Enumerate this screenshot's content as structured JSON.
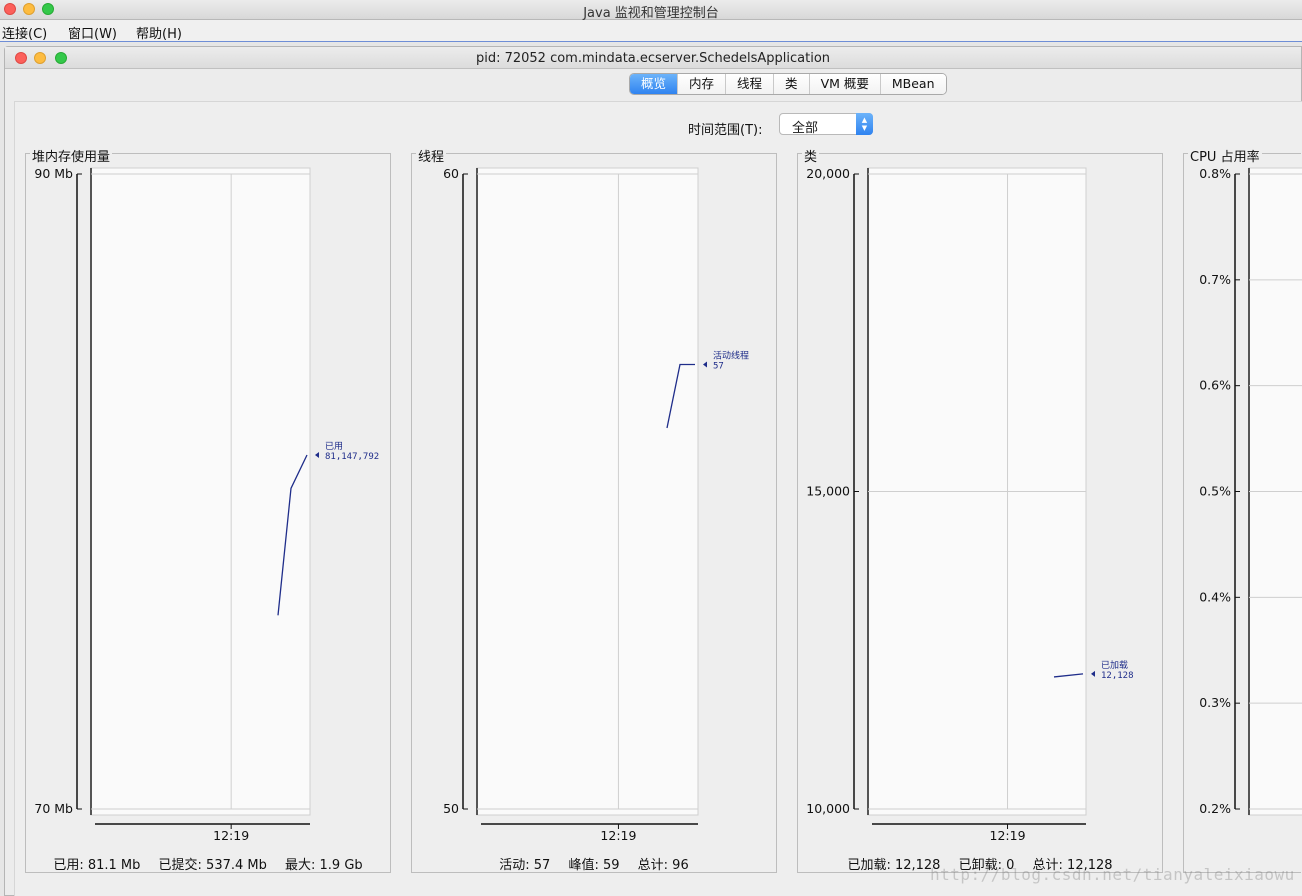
{
  "app": {
    "title": "Java 监视和管理控制台"
  },
  "menu": [
    "连接(C)",
    "窗口(W)",
    "帮助(H)"
  ],
  "window": {
    "title": "pid: 72052 com.mindata.ecserver.SchedelsApplication"
  },
  "tabs": [
    {
      "label": "概览",
      "active": true
    },
    {
      "label": "内存",
      "active": false
    },
    {
      "label": "线程",
      "active": false
    },
    {
      "label": "类",
      "active": false
    },
    {
      "label": "VM 概要",
      "active": false
    },
    {
      "label": "MBean",
      "active": false
    }
  ],
  "time_range": {
    "label": "时间范围(T):",
    "value": "全部"
  },
  "panels": {
    "heap": {
      "title": "堆内存使用量",
      "footer": {
        "used": "已用: 81.1 Mb",
        "committed": "已提交: 537.4 Mb",
        "max": "最大: 1.9 Gb"
      }
    },
    "threads": {
      "title": "线程",
      "footer": {
        "live": "活动: 57",
        "peak": "峰值: 59",
        "total": "总计: 96"
      }
    },
    "classes": {
      "title": "类",
      "footer": {
        "loaded": "已加载: 12,128",
        "unloaded": "已卸载: 0",
        "total": "总计: 12,128"
      }
    },
    "cpu": {
      "title": "CPU 占用率"
    }
  },
  "chart_data": [
    {
      "type": "line",
      "title": "堆内存使用量",
      "y_ticks": [
        "90 Mb",
        "70 Mb"
      ],
      "x_ticks": [
        "12:19"
      ],
      "ylim_mb": [
        70,
        90
      ],
      "series": [
        {
          "name": "已用",
          "label": "81,147,792",
          "values_mb": [
            76.1,
            80.1,
            81.15
          ]
        }
      ],
      "color": "#1f2d8a"
    },
    {
      "type": "line",
      "title": "线程",
      "y_ticks": [
        "60",
        "50"
      ],
      "x_ticks": [
        "12:19"
      ],
      "ylim": [
        50,
        60
      ],
      "series": [
        {
          "name": "活动线程",
          "label": "57",
          "values": [
            56,
            57,
            57
          ]
        }
      ],
      "color": "#1f2d8a"
    },
    {
      "type": "line",
      "title": "类",
      "y_ticks": [
        "20,000",
        "15,000",
        "10,000"
      ],
      "x_ticks": [
        "12:19"
      ],
      "ylim": [
        10000,
        20000
      ],
      "series": [
        {
          "name": "已加载",
          "label": "12,128",
          "values": [
            12080,
            12128
          ]
        }
      ],
      "color": "#1f2d8a"
    },
    {
      "type": "line",
      "title": "CPU 占用率",
      "y_ticks": [
        "0.8%",
        "0.7%",
        "0.6%",
        "0.5%",
        "0.4%",
        "0.3%",
        "0.2%"
      ],
      "ylim": [
        0.2,
        0.8
      ]
    }
  ],
  "watermark": "http://blog.csdn.net/tianyaleixiaowu"
}
